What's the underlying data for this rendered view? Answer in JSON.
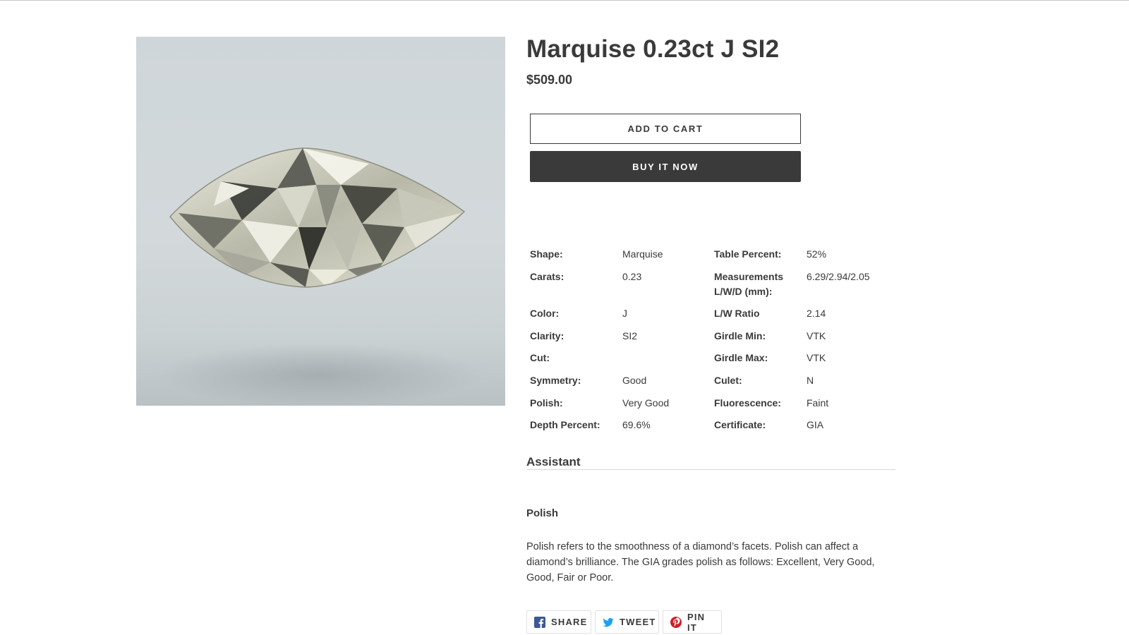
{
  "product": {
    "title": "Marquise 0.23ct J SI2",
    "price": "$509.00",
    "image_alt": "marquise diamond photo"
  },
  "actions": {
    "add_to_cart": "ADD TO CART",
    "buy_now": "BUY IT NOW"
  },
  "specs": [
    {
      "label": "Shape:",
      "value": "Marquise",
      "label2": "Table Percent:",
      "value2": "52%"
    },
    {
      "label": "Carats:",
      "value": "0.23",
      "label2": "Measurements L/W/D (mm):",
      "value2": "6.29/2.94/2.05"
    },
    {
      "label": "Color:",
      "value": "J",
      "label2": "L/W Ratio",
      "value2": "2.14"
    },
    {
      "label": "Clarity:",
      "value": "SI2",
      "label2": "Girdle Min:",
      "value2": "VTK"
    },
    {
      "label": "Cut:",
      "value": "",
      "label2": "Girdle Max:",
      "value2": "VTK"
    },
    {
      "label": "Symmetry:",
      "value": "Good",
      "label2": "Culet:",
      "value2": "N"
    },
    {
      "label": "Polish:",
      "value": "Very Good",
      "label2": "Fluorescence:",
      "value2": "Faint"
    },
    {
      "label": "Depth Percent:",
      "value": "69.6%",
      "label2": "Certificate:",
      "value2": "GIA"
    }
  ],
  "assistant": {
    "heading": "Assistant",
    "topic_heading": "Polish",
    "topic_text": "Polish refers to the smoothness of a diamond’s facets. Polish can affect a diamond’s brilliance. The GIA grades polish as follows: Excellent, Very Good, Good, Fair or Poor."
  },
  "share": {
    "facebook_label": "SHARE",
    "twitter_label": "TWEET",
    "pinterest_label": "PIN IT",
    "facebook_icon": "facebook-icon",
    "twitter_icon": "twitter-icon",
    "pinterest_icon": "pinterest-icon"
  },
  "colors": {
    "text": "#3a3a3a",
    "buy_button": "#3a3a3a",
    "facebook": "#3b5998",
    "twitter": "#1da1f2",
    "pinterest": "#cb2027"
  }
}
